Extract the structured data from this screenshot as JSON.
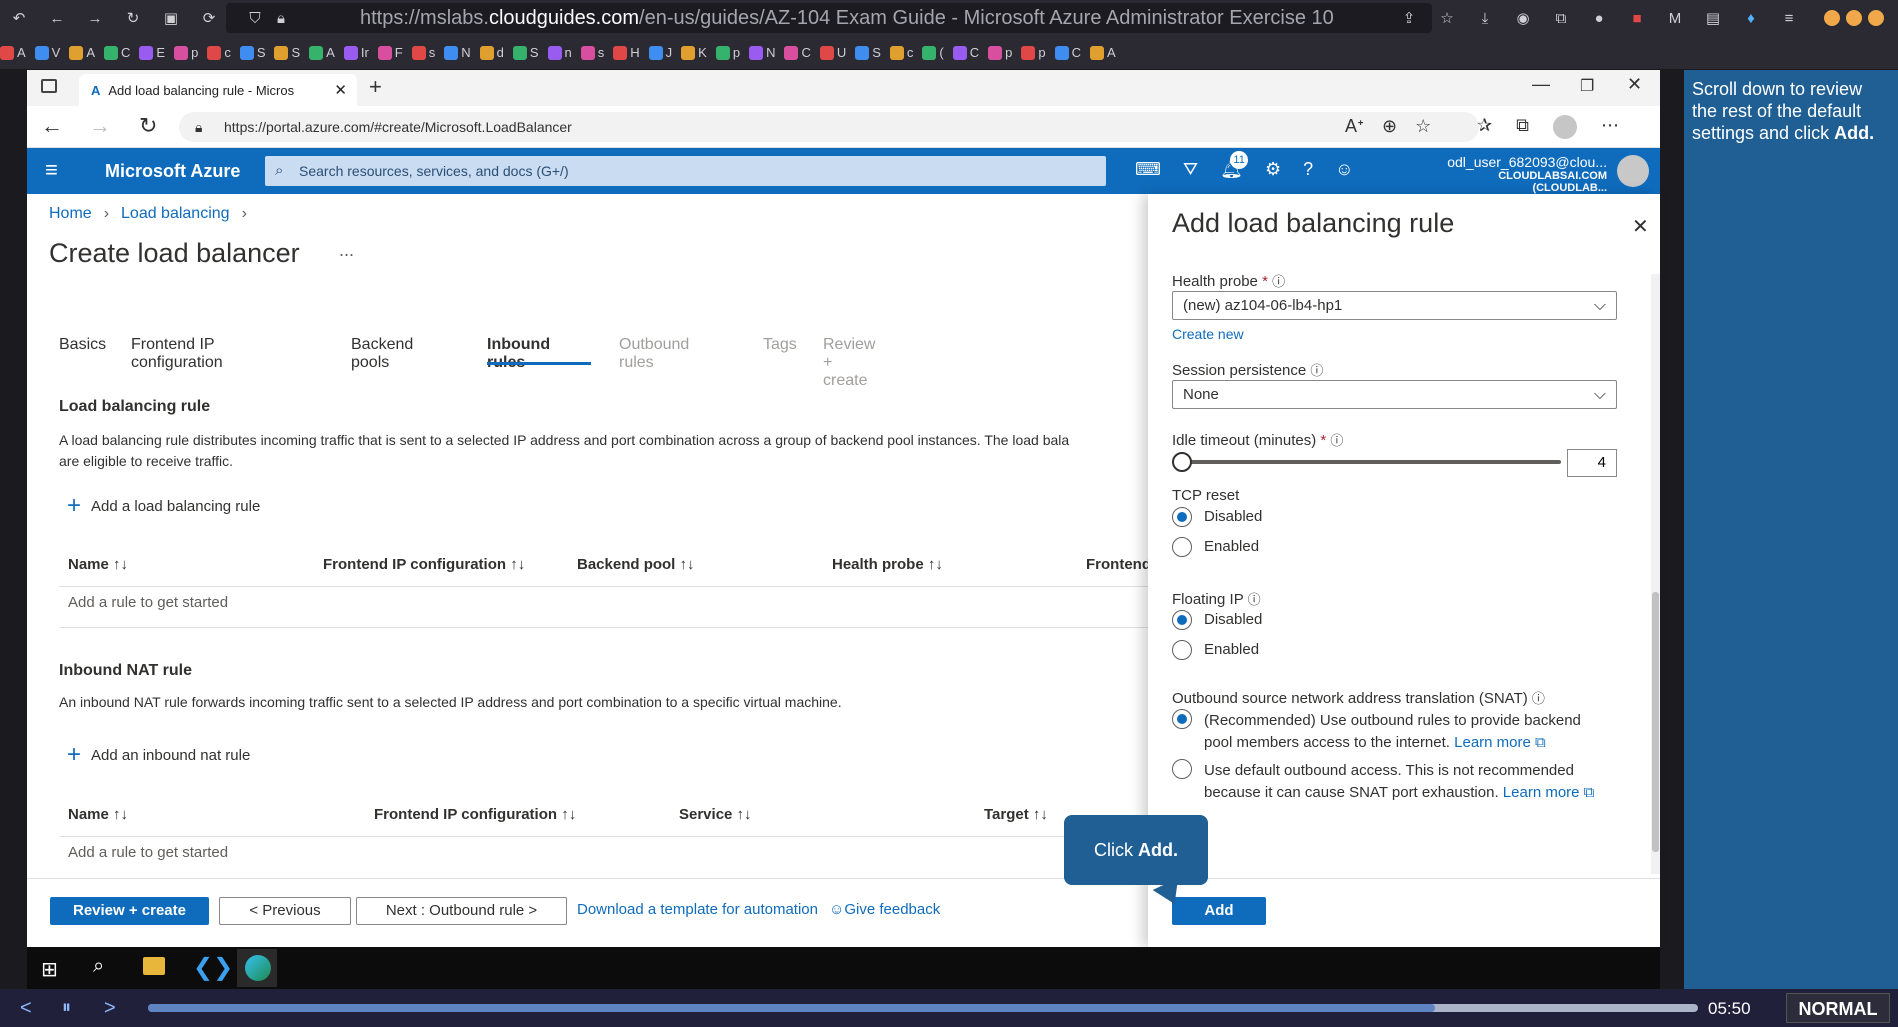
{
  "outer_browser": {
    "url_prefix": "https://mslabs.",
    "url_domain": "cloudguides.com",
    "url_rest": "/en-us/guides/AZ-104 Exam Guide - Microsoft Azure Administrator Exercise 10",
    "bookmarks": [
      "A",
      "V",
      "A",
      "C",
      "E",
      "p",
      "c",
      "S",
      "S",
      "A",
      "Ir",
      "F",
      "s",
      "N",
      "d",
      "S",
      "n",
      "s",
      "H",
      "J",
      "K",
      "p",
      "N",
      "C",
      "U",
      "S",
      "c",
      "(",
      "C",
      "p",
      "p",
      "C",
      "A"
    ]
  },
  "inner_browser": {
    "tab_title": "Add load balancing rule - Micros",
    "url": "https://portal.azure.com/#create/Microsoft.LoadBalancer"
  },
  "azure": {
    "brand": "Microsoft Azure",
    "search_placeholder": "Search resources, services, and docs (G+/)",
    "notif_count": "11",
    "user_name": "odl_user_682093@clou...",
    "user_tenant": "CLOUDLABSAI.COM (CLOUDLAB..."
  },
  "page": {
    "breadcrumb": [
      "Home",
      "Load balancing"
    ],
    "title": "Create load balancer",
    "more": "...",
    "tabs": [
      "Basics",
      "Frontend IP configuration",
      "Backend pools",
      "Inbound rules",
      "Outbound rules",
      "Tags",
      "Review + create"
    ],
    "lb_section_title": "Load balancing rule",
    "lb_desc_1": "A load balancing rule distributes incoming traffic that is sent to a selected IP address and port combination across a group of backend pool instances. The load bala",
    "lb_desc_2": "are eligible to receive traffic.",
    "add_lb_rule": "Add a load balancing rule",
    "lb_cols": [
      "Name",
      "Frontend IP configuration",
      "Backend pool",
      "Health probe",
      "Frontend"
    ],
    "lb_empty": "Add a rule to get started",
    "nat_section_title": "Inbound NAT rule",
    "nat_desc": "An inbound NAT rule forwards incoming traffic sent to a selected IP address and port combination to a specific virtual machine.",
    "add_nat_rule": "Add an inbound nat rule",
    "nat_cols": [
      "Name",
      "Frontend IP configuration",
      "Service",
      "Target"
    ],
    "nat_empty": "Add a rule to get started",
    "btn_review": "Review + create",
    "btn_prev": "< Previous",
    "btn_next": "Next : Outbound rule >",
    "link_template": "Download a template for automation",
    "link_feedback": "Give feedback"
  },
  "panel": {
    "title": "Add load balancing rule",
    "health_probe_label": "Health probe",
    "health_probe_value": "(new) az104-06-lb4-hp1",
    "create_new": "Create new",
    "session_label": "Session persistence",
    "session_value": "None",
    "idle_label": "Idle timeout (minutes)",
    "idle_value": "4",
    "tcp_label": "TCP reset",
    "tcp_opt1": "Disabled",
    "tcp_opt2": "Enabled",
    "float_label": "Floating IP",
    "float_opt1": "Disabled",
    "float_opt2": "Enabled",
    "snat_label": "Outbound source network address translation (SNAT)",
    "snat_opt1_a": "(Recommended) Use outbound rules to provide backend",
    "snat_opt1_b": "pool members access to the internet.",
    "snat_opt2_a": "Use default outbound access. This is not recommended",
    "snat_opt2_b": "because it can cause SNAT port exhaustion.",
    "learn_more": "Learn more",
    "btn_add": "Add"
  },
  "tooltip": {
    "text_pre": "Click ",
    "text_bold": "Add."
  },
  "guide": {
    "text": "Scroll down to review the rest of the default settings and click ",
    "bold": "Add."
  },
  "player": {
    "time": "05:50",
    "mode": "NORMAL",
    "progress": 0.83
  },
  "colors": {
    "azure_blue": "#0f6cbd",
    "guide_blue": "#1f5f94"
  }
}
